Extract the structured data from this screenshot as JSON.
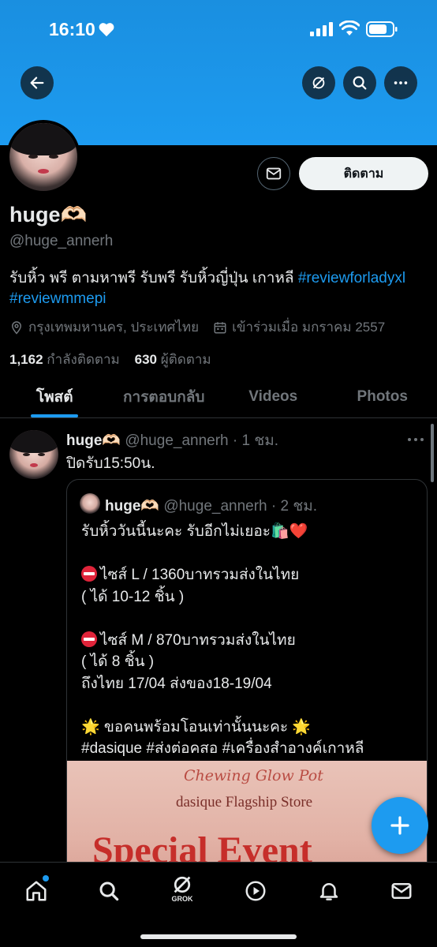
{
  "status_bar": {
    "time": "16:10"
  },
  "profile": {
    "display_name": "huge🫶🏻",
    "handle": "@huge_annerh",
    "follow_label": "ติดตาม",
    "bio_text": "รับหิ้ว พรี ตามหาพรี รับพรี รับหิ้วญี่ปุ่น เกาหลี ",
    "bio_tag1": "#reviewforladyxl",
    "bio_tag2": "#reviewmmepi",
    "location": "กรุงเทพมหานคร, ประเทศไทย",
    "joined": "เข้าร่วมเมื่อ มกราคม 2557",
    "following_count": "1,162",
    "following_label": "กำลังติดตาม",
    "followers_count": "630",
    "followers_label": "ผู้ติดตาม"
  },
  "tabs": [
    {
      "label": "โพสต์",
      "active": true
    },
    {
      "label": "การตอบกลับ",
      "active": false
    },
    {
      "label": "Videos",
      "active": false
    },
    {
      "label": "Photos",
      "active": false
    }
  ],
  "post": {
    "name": "huge🫶🏻",
    "handle_time": "@huge_annerh · 1 ชม.",
    "text": "ปิดรับ15:50น.",
    "quote": {
      "name": "huge🫶🏻",
      "handle_time": "@huge_annerh · 2 ชม.",
      "line1": "รับหิ้ววันนี้นะคะ  รับอีกไม่เยอะ🛍️❤️",
      "line2": "ไซส์ L / 1360บาทรวมส่งในไทย",
      "line3": "( ได้ 10-12 ชิ้น )",
      "line4": "ไซส์ M / 870บาทรวมส่งในไทย",
      "line5": "( ได้ 8 ชิ้น )",
      "line6": "ถึงไทย 17/04  ส่งของ18-19/04",
      "line7": "🌟 ขอคนพร้อมโอนเท่านั้นนะคะ 🌟",
      "line8": "#dasique #ส่งต่อคสอ #เครื่องสำอางค์เกาหลี",
      "image": {
        "script_text": "Chewing Glow Pot",
        "store_text": "dasique Flagship Store",
        "event_text": "Special Event"
      }
    }
  },
  "bottom_nav": {
    "grok_label": "GROK"
  },
  "colors": {
    "accent": "#1d9bf0",
    "background": "#000000",
    "muted": "#71767b"
  }
}
